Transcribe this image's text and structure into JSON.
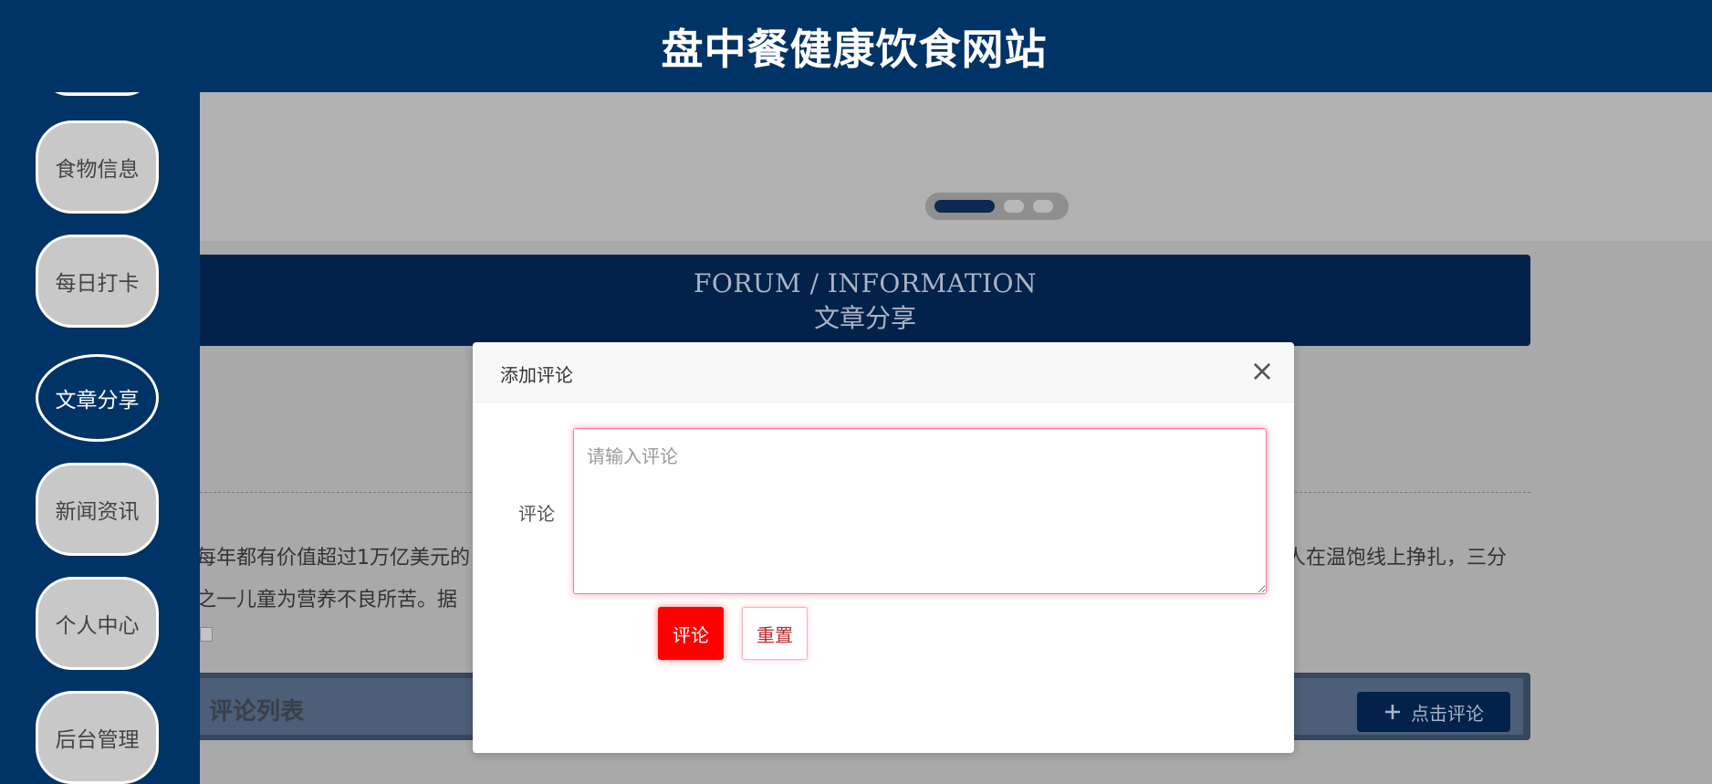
{
  "header": {
    "title": "盘中餐健康饮食网站"
  },
  "sidebar": {
    "items": [
      {
        "label": "食物信息"
      },
      {
        "label": "每日打卡"
      },
      {
        "label": "文章分享",
        "active": true
      },
      {
        "label": "新闻资讯"
      },
      {
        "label": "个人中心"
      },
      {
        "label": "后台管理"
      }
    ]
  },
  "main": {
    "forum": {
      "en": "FORUM / INFORMATION",
      "cn": "文章分享"
    },
    "article": {
      "line1_start": "每年都有价值超过1万亿美元的",
      "line1_end": "人在温饱线上挣扎，三分",
      "line2_start": "之一儿童为营养不良所苦。据"
    },
    "comments": {
      "title": "评论列表",
      "add_label": "点击评论",
      "add_icon": "plus-icon"
    }
  },
  "modal": {
    "title": "添加评论",
    "field_label": "评论",
    "textarea": {
      "placeholder": "请输入评论",
      "value": ""
    },
    "submit_label": "评论",
    "reset_label": "重置"
  },
  "colors": {
    "primary_navy": "#003366",
    "accent_red": "#ff0000",
    "overlay_gray": "#b0b0b0"
  }
}
